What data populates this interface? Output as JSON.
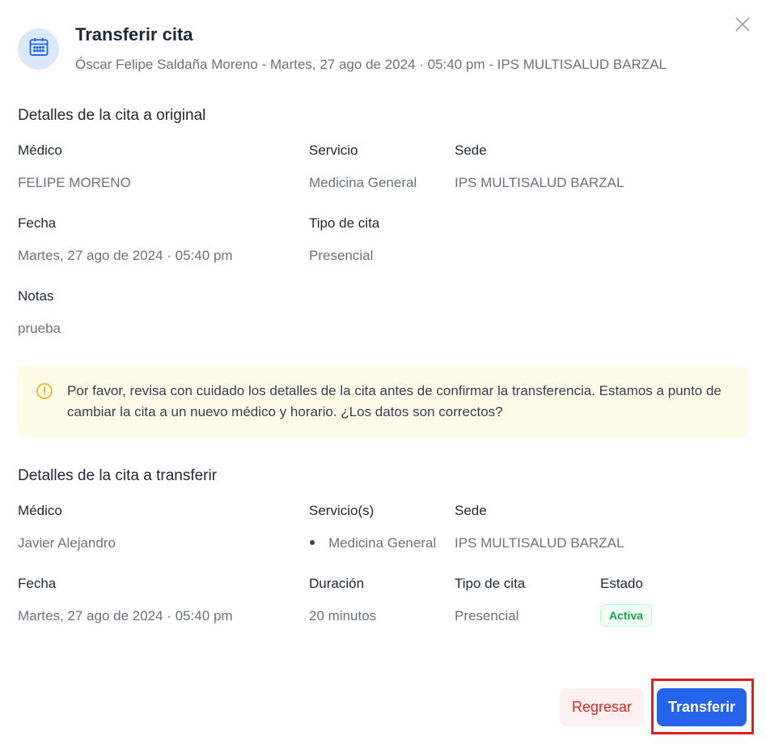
{
  "header": {
    "title": "Transferir cita",
    "subtitle": "Óscar Felipe Saldaña Moreno - Martes, 27 ago de 2024 · 05:40 pm - IPS MULTISALUD BARZAL",
    "icon": "calendar-icon",
    "close_icon": "close-icon"
  },
  "original": {
    "section_title": "Detalles de la cita a original",
    "medico_label": "Médico",
    "medico_value": "FELIPE MORENO",
    "servicio_label": "Servicio",
    "servicio_value": "Medicina General",
    "sede_label": "Sede",
    "sede_value": "IPS MULTISALUD BARZAL",
    "fecha_label": "Fecha",
    "fecha_value": "Martes, 27 ago de 2024 · 05:40 pm",
    "tipo_label": "Tipo de cita",
    "tipo_value": "Presencial",
    "notas_label": "Notas",
    "notas_value": "prueba"
  },
  "notice": {
    "icon": "warning-circle-icon",
    "text": "Por favor, revisa con cuidado los detalles de la cita antes de confirmar la transferencia. Estamos a punto de cambiar la cita a un nuevo médico y horario. ¿Los datos son correctos?"
  },
  "transfer": {
    "section_title": "Detalles de la cita a transferir",
    "medico_label": "Médico",
    "medico_value": "Javier Alejandro",
    "servicios_label": "Servicio(s)",
    "servicios_value": "Medicina General",
    "sede_label": "Sede",
    "sede_value": "IPS MULTISALUD BARZAL",
    "fecha_label": "Fecha",
    "fecha_value": "Martes, 27 ago de 2024 · 05:40 pm",
    "duracion_label": "Duración",
    "duracion_value": "20 minutos",
    "tipo_label": "Tipo de cita",
    "tipo_value": "Presencial",
    "estado_label": "Estado",
    "estado_value": "Activa"
  },
  "actions": {
    "back_label": "Regresar",
    "transfer_label": "Transferir"
  },
  "colors": {
    "primary": "#2563eb",
    "danger": "#dc2626",
    "success": "#16a34a",
    "notice_bg": "#fefbe8",
    "warning": "#eab308"
  }
}
